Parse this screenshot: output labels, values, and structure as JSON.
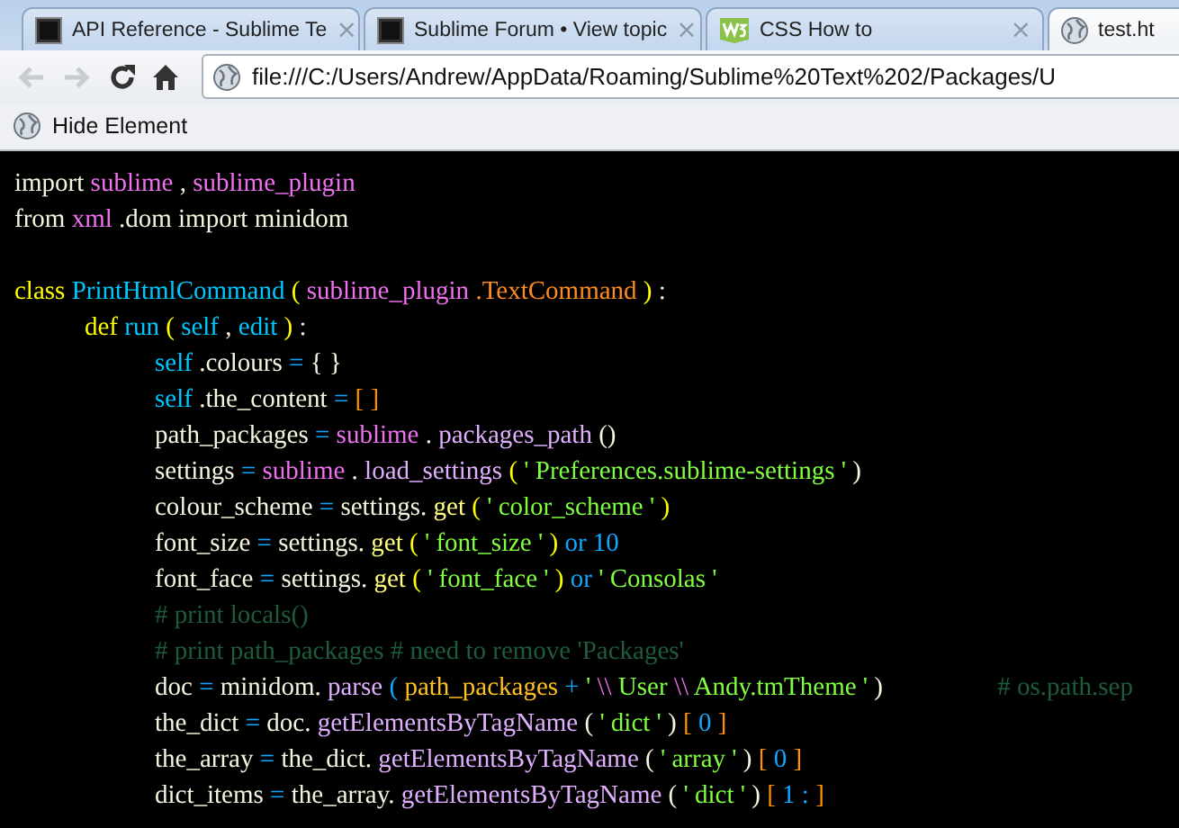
{
  "tabs": [
    {
      "title": "API Reference - Sublime Te",
      "kind": "page",
      "selected": false,
      "close": "×"
    },
    {
      "title": "Sublime Forum • View topic",
      "kind": "page",
      "selected": false,
      "close": "×"
    },
    {
      "title": "CSS How to",
      "kind": "w3",
      "selected": false,
      "close": "×"
    },
    {
      "title": "test.ht",
      "kind": "globe",
      "selected": true
    }
  ],
  "toolbar": {
    "back_disabled": true,
    "forward_disabled": true,
    "address": "file:///C:/Users/Andrew/AppData/Roaming/Sublime%20Text%202/Packages/U"
  },
  "bookmarks": [
    {
      "label": "Hide Element"
    }
  ],
  "code": [
    {
      "tokens": [
        {
          "text": "import",
          "color": "#f5f5e0"
        },
        {
          "text": "sublime",
          "color": "#f070f0"
        },
        {
          "text": ",",
          "color": "#f5f5e0"
        },
        {
          "text": "sublime_plugin",
          "color": "#f070f0"
        }
      ]
    },
    {
      "tokens": [
        {
          "text": "from",
          "color": "#f5f5e0"
        },
        {
          "text": "xml",
          "color": "#f070f0"
        },
        {
          "text": ".dom import minidom",
          "color": "#f5f5e0"
        }
      ]
    },
    {
      "gap_before": true,
      "tokens": [
        {
          "text": "class",
          "color": "#ffff00"
        },
        {
          "text": "PrintHtmlCommand",
          "color": "#00c8ff"
        },
        {
          "text": "(",
          "color": "#ffff00"
        },
        {
          "text": "sublime_plugin",
          "color": "#f070f0"
        },
        {
          "text": ".TextCommand",
          "color": "#ff8c20"
        },
        {
          "text": ")",
          "color": "#ffff00"
        },
        {
          "text": ":",
          "color": "#f5f5e0"
        }
      ],
      "children": [
        {
          "tokens": [
            {
              "text": "def",
              "color": "#ffff00"
            },
            {
              "text": "run",
              "color": "#00c8ff"
            },
            {
              "text": "(",
              "color": "#ffff00"
            },
            {
              "text": "self",
              "color": "#00c8ff"
            },
            {
              "text": ",",
              "color": "#f5f5e0"
            },
            {
              "text": "edit",
              "color": "#00c8ff"
            },
            {
              "text": ")",
              "color": "#ffff00"
            },
            {
              "text": ":",
              "color": "#f5f5e0"
            }
          ],
          "children": [
            {
              "tokens": [
                {
                  "text": "self",
                  "color": "#00c8ff"
                },
                {
                  "text": ".colours",
                  "color": "#f5f5e0"
                },
                {
                  "text": "=",
                  "color": "#10a8ff"
                },
                {
                  "text": "{ }",
                  "color": "#f5f5e0"
                }
              ]
            },
            {
              "tokens": [
                {
                  "text": "self",
                  "color": "#00c8ff"
                },
                {
                  "text": ".the_content",
                  "color": "#f5f5e0"
                },
                {
                  "text": "=",
                  "color": "#10a8ff"
                },
                {
                  "text": "[ ]",
                  "color": "#ff9000"
                }
              ]
            },
            {
              "tokens": [
                {
                  "text": "path_packages",
                  "color": "#f5f5e0"
                },
                {
                  "text": "=",
                  "color": "#10a8ff"
                },
                {
                  "text": "sublime",
                  "color": "#f070f0"
                },
                {
                  "text": ".",
                  "color": "#f5f5e0"
                },
                {
                  "text": "packages_path",
                  "color": "#e0b0ff"
                },
                {
                  "text": "()",
                  "color": "#f5f5e0"
                }
              ]
            },
            {
              "tokens": [
                {
                  "text": "settings",
                  "color": "#f5f5e0"
                },
                {
                  "text": "=",
                  "color": "#10a8ff"
                },
                {
                  "text": "sublime",
                  "color": "#f070f0"
                },
                {
                  "text": ".",
                  "color": "#f5f5e0"
                },
                {
                  "text": "load_settings",
                  "color": "#e0b0ff"
                },
                {
                  "text": "(",
                  "color": "#ffff00"
                },
                {
                  "text": "' Preferences.sublime-settings '",
                  "color": "#80ff40"
                },
                {
                  "text": ")",
                  "color": "#f5f5e0"
                }
              ]
            },
            {
              "tokens": [
                {
                  "text": "colour_scheme",
                  "color": "#f5f5e0"
                },
                {
                  "text": "=",
                  "color": "#10a8ff"
                },
                {
                  "text": "settings.",
                  "color": "#f5f5e0"
                },
                {
                  "text": "get",
                  "color": "#ffff80"
                },
                {
                  "text": "(",
                  "color": "#ffff00"
                },
                {
                  "text": "' color_scheme '",
                  "color": "#80ff40"
                },
                {
                  "text": ")",
                  "color": "#ffff00"
                }
              ]
            },
            {
              "tokens": [
                {
                  "text": "font_size",
                  "color": "#f5f5e0"
                },
                {
                  "text": "=",
                  "color": "#10a8ff"
                },
                {
                  "text": "settings.",
                  "color": "#f5f5e0"
                },
                {
                  "text": "get",
                  "color": "#ffff80"
                },
                {
                  "text": "(",
                  "color": "#ffff00"
                },
                {
                  "text": "' font_size '",
                  "color": "#80ff40"
                },
                {
                  "text": ")",
                  "color": "#ffff00"
                },
                {
                  "text": "or 10",
                  "color": "#10a8ff"
                }
              ]
            },
            {
              "tokens": [
                {
                  "text": "font_face",
                  "color": "#f5f5e0"
                },
                {
                  "text": "=",
                  "color": "#10a8ff"
                },
                {
                  "text": "settings.",
                  "color": "#f5f5e0"
                },
                {
                  "text": "get",
                  "color": "#ffff80"
                },
                {
                  "text": "(",
                  "color": "#ffff00"
                },
                {
                  "text": "' font_face '",
                  "color": "#80ff40"
                },
                {
                  "text": ")",
                  "color": "#ffff00"
                },
                {
                  "text": "or",
                  "color": "#10a8ff"
                },
                {
                  "text": "' Consolas '",
                  "color": "#80ff40"
                }
              ]
            },
            {
              "tokens": [
                {
                  "text": "# print locals()",
                  "color": "#1f5c3c"
                }
              ]
            },
            {
              "tokens": [
                {
                  "text": "# print path_packages # need to remove 'Packages'",
                  "color": "#1f5c3c"
                }
              ]
            },
            {
              "tokens": [
                {
                  "text": "doc",
                  "color": "#f5f5e0"
                },
                {
                  "text": "=",
                  "color": "#10a8ff"
                },
                {
                  "text": "minidom.",
                  "color": "#f5f5e0"
                },
                {
                  "text": "parse",
                  "color": "#e0b0ff"
                },
                {
                  "text": "(",
                  "color": "#10a8ff"
                },
                {
                  "text": "path_packages",
                  "color": "#ffc020"
                },
                {
                  "text": "+",
                  "color": "#10a8ff"
                },
                {
                  "text": "'",
                  "color": "#80ff40"
                },
                {
                  "text": "\\\\",
                  "color": "#f070f0"
                },
                {
                  "text": "User",
                  "color": "#80ff40"
                },
                {
                  "text": "\\\\",
                  "color": "#f070f0"
                },
                {
                  "text": "Andy.tmTheme '",
                  "color": "#80ff40"
                },
                {
                  "text": ")",
                  "color": "#f5f5e0"
                },
                {
                  "text": "# os.path.sep",
                  "color": "#1f5c3c",
                  "gap_before": true
                }
              ]
            },
            {
              "tokens": [
                {
                  "text": "the_dict",
                  "color": "#f5f5e0"
                },
                {
                  "text": "=",
                  "color": "#10a8ff"
                },
                {
                  "text": "doc.",
                  "color": "#f5f5e0"
                },
                {
                  "text": "getElementsByTagName",
                  "color": "#e0b0ff"
                },
                {
                  "text": "(",
                  "color": "#f5f5e0"
                },
                {
                  "text": "' dict '",
                  "color": "#80ff40"
                },
                {
                  "text": ")",
                  "color": "#f5f5e0"
                },
                {
                  "text": "[",
                  "color": "#ff9000"
                },
                {
                  "text": "0",
                  "color": "#10a8ff"
                },
                {
                  "text": "]",
                  "color": "#ff9000"
                }
              ]
            },
            {
              "tokens": [
                {
                  "text": "the_array",
                  "color": "#f5f5e0"
                },
                {
                  "text": "=",
                  "color": "#10a8ff"
                },
                {
                  "text": "the_dict.",
                  "color": "#f5f5e0"
                },
                {
                  "text": "getElementsByTagName",
                  "color": "#e0b0ff"
                },
                {
                  "text": "(",
                  "color": "#f5f5e0"
                },
                {
                  "text": "' array '",
                  "color": "#80ff40"
                },
                {
                  "text": ")",
                  "color": "#f5f5e0"
                },
                {
                  "text": "[",
                  "color": "#ff9000"
                },
                {
                  "text": "0",
                  "color": "#10a8ff"
                },
                {
                  "text": "]",
                  "color": "#ff9000"
                }
              ]
            },
            {
              "tokens": [
                {
                  "text": "dict_items",
                  "color": "#f5f5e0"
                },
                {
                  "text": "=",
                  "color": "#10a8ff"
                },
                {
                  "text": "the_array.",
                  "color": "#f5f5e0"
                },
                {
                  "text": "getElementsByTagName",
                  "color": "#e0b0ff"
                },
                {
                  "text": "(",
                  "color": "#f5f5e0"
                },
                {
                  "text": "' dict '",
                  "color": "#80ff40"
                },
                {
                  "text": ")",
                  "color": "#f5f5e0"
                },
                {
                  "text": "[",
                  "color": "#ff9000"
                },
                {
                  "text": "1 :",
                  "color": "#10a8ff"
                },
                {
                  "text": "]",
                  "color": "#ff9000"
                }
              ]
            }
          ]
        }
      ]
    }
  ]
}
